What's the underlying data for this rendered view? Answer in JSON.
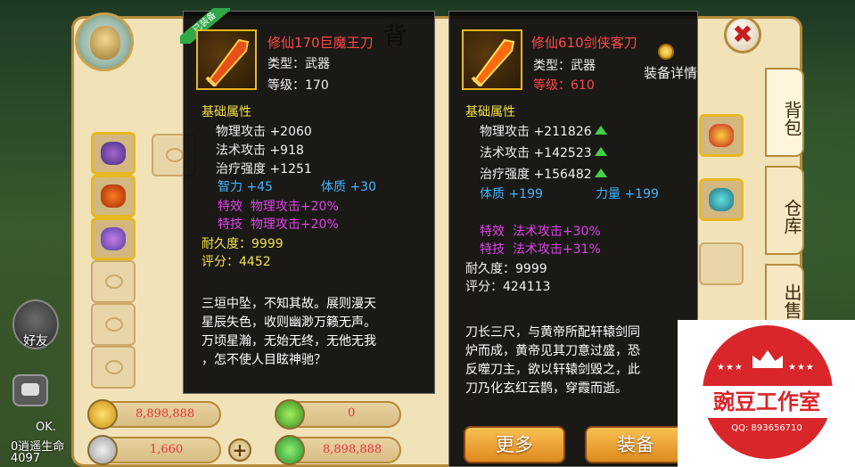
{
  "bag": {
    "title": "背",
    "tabs": [
      "背包",
      "仓库",
      "出售"
    ],
    "close_label": "✖"
  },
  "resources": {
    "gold": "8,898,888",
    "silver": "1,660",
    "jade": "0",
    "energy": "8,898,888",
    "plus_label": "+"
  },
  "social": {
    "friend_label": "好友",
    "log_line1": "OK.",
    "log_line2": "0逍遥生命",
    "log_line3": "4097"
  },
  "item_equipped": {
    "ribbon": "已装备",
    "name": "修仙170巨魔王刀",
    "type": "类型：武器",
    "level": "等级：170",
    "base_header": "基础属性",
    "stats": [
      {
        "label": "物理攻击",
        "value": "+2060"
      },
      {
        "label": "法术攻击",
        "value": "+918"
      },
      {
        "label": "治疗强度",
        "value": "+1251"
      }
    ],
    "extra": [
      {
        "label": "智力",
        "value": "+45"
      },
      {
        "label": "体质",
        "value": "+30"
      }
    ],
    "effect_label": "特效",
    "effect_value": "物理攻击+20%",
    "skill_label": "特技",
    "skill_value": "物理攻击+20%",
    "durability": "耐久度：9999",
    "score": "评分：4452",
    "desc": [
      "三垣中坠，不知其故。展则漫天",
      "星辰失色，收则幽渺万籁无声。",
      "万顷星瀚，无始无终，无他无我",
      "，怎不使人目眩神驰？"
    ]
  },
  "item_compare": {
    "name": "修仙610剑侠客刀",
    "type": "类型：武器",
    "level": "等级：610",
    "detail_link": "装备详情",
    "base_header": "基础属性",
    "stats": [
      {
        "label": "物理攻击",
        "value": "+211826"
      },
      {
        "label": "法术攻击",
        "value": "+142523"
      },
      {
        "label": "治疗强度",
        "value": "+156482"
      }
    ],
    "extra": [
      {
        "label": "体质",
        "value": "+199"
      },
      {
        "label": "力量",
        "value": "+199"
      }
    ],
    "effect_label": "特效",
    "effect_value": "法术攻击+30%",
    "skill_label": "特技",
    "skill_value": "法术攻击+31%",
    "durability": "耐久度：9999",
    "score": "评分：424113",
    "desc": [
      "刀长三尺，与黄帝所配轩辕剑同",
      "炉而成，黄帝见其刀意过盛，恐",
      "反噬刀主，欲以轩辕剑毁之，此",
      "刀乃化玄红云鹊，穿霞而逝。"
    ],
    "more_button": "更多",
    "equip_button": "装备"
  },
  "watermark": {
    "title": "豌豆工作室",
    "qq": "QQ: 893656710",
    "stars_left": "★★★",
    "stars_right": "★★★"
  },
  "colors": {
    "name_red": "#ff4a4a",
    "attr_yellow": "#f5e14a",
    "attr_blue": "#3fb4ff",
    "attr_purple": "#e044e8",
    "up_green": "#44d04a",
    "button_orange": "#e08a20",
    "stamp_red": "#d8262a"
  }
}
